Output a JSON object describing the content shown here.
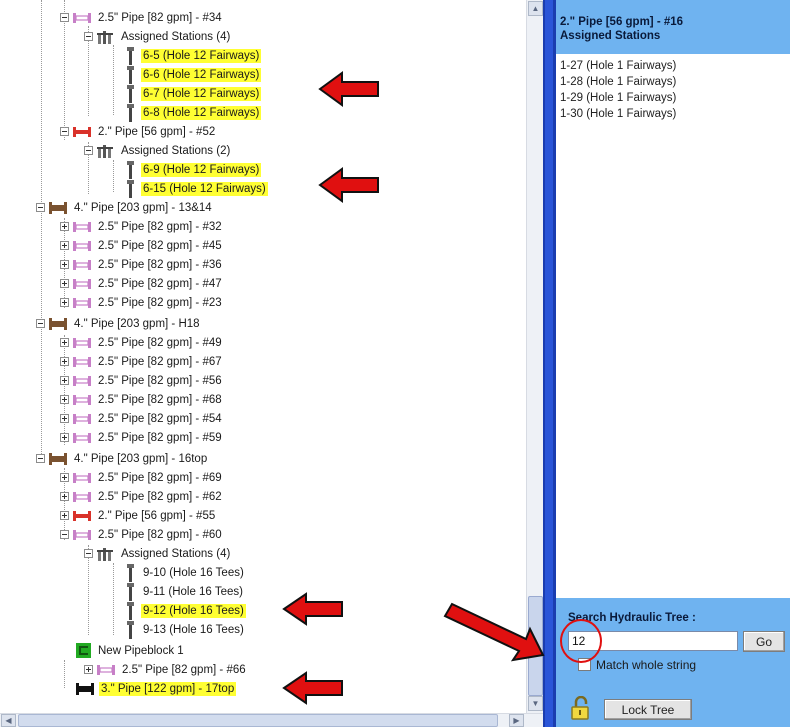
{
  "tree": {
    "rows": [
      "2.5\" Pipe [82 gpm] - #34",
      "Assigned Stations (4)",
      "6-5  (Hole 12 Fairways)",
      "6-6  (Hole 12 Fairways)",
      "6-7  (Hole 12 Fairways)",
      "6-8  (Hole 12 Fairways)",
      "2.\" Pipe [56 gpm] - #52",
      "Assigned Stations (2)",
      "6-9  (Hole 12 Fairways)",
      "6-15  (Hole 12 Fairways)",
      "4.\" Pipe [203 gpm] - 13&14",
      "2.5\" Pipe [82 gpm] - #32",
      "2.5\" Pipe [82 gpm] - #45",
      "2.5\" Pipe [82 gpm] - #36",
      "2.5\" Pipe [82 gpm] - #47",
      "2.5\" Pipe [82 gpm] - #23",
      "4.\" Pipe [203 gpm] - H18",
      "2.5\" Pipe [82 gpm] - #49",
      "2.5\" Pipe [82 gpm] - #67",
      "2.5\" Pipe [82 gpm] - #56",
      "2.5\" Pipe [82 gpm] - #68",
      "2.5\" Pipe [82 gpm] - #54",
      "2.5\" Pipe [82 gpm] - #59",
      "4.\" Pipe [203 gpm] - 16top",
      "2.5\" Pipe [82 gpm] - #69",
      "2.5\" Pipe [82 gpm] - #62",
      "2.\" Pipe [56 gpm] - #55",
      "2.5\" Pipe [82 gpm] - #60",
      "Assigned Stations (4)",
      "9-10  (Hole 16 Tees)",
      "9-11  (Hole 16 Tees)",
      "9-12  (Hole 16 Tees)",
      "9-13  (Hole 16 Tees)",
      "New Pipeblock 1",
      "2.5\" Pipe [82 gpm] - #66",
      "3.\" Pipe [122 gpm] - 17top"
    ]
  },
  "detail": {
    "title_line1": "2.\" Pipe [56 gpm] - #16",
    "title_line2": "Assigned Stations",
    "items": [
      "1-27  (Hole 1 Fairways)",
      "1-28  (Hole 1 Fairways)",
      "1-29  (Hole 1 Fairways)",
      "1-30  (Hole 1 Fairways)"
    ]
  },
  "search": {
    "label": "Search Hydraulic Tree :",
    "value": "12",
    "go_label": "Go",
    "match_label": "Match whole string",
    "match_checked": false
  },
  "lock_button_label": "Lock Tree",
  "colors": {
    "highlight": "#ffff33",
    "panel_blue": "#6fb3f0",
    "splitter_blue": "#2a55d8",
    "annotation_red": "#e01010",
    "pipe_2_5": "#c77fc7",
    "pipe_2": "#d9322a",
    "pipe_4": "#7a5230",
    "pipe_3": "#111111",
    "pipeblock": "#22aa22"
  },
  "icons": {
    "expander": "tree-expander-icon",
    "pipe": "pipe-icon",
    "stations": "station-group-icon",
    "station": "station-icon",
    "pipeblock": "pipeblock-icon",
    "lock": "lock-icon",
    "arrow": "red-arrow-icon"
  }
}
